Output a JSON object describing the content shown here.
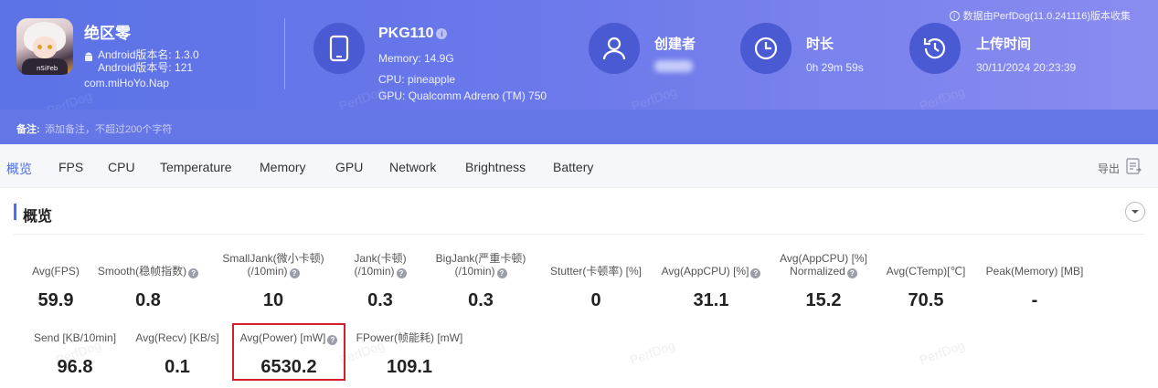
{
  "app": {
    "name": "绝区零",
    "version_name": "Android版本名: 1.3.0",
    "version_code": "Android版本号: 121",
    "package": "com.miHoYo.Nap",
    "icon_tag": "nSiFeb"
  },
  "device": {
    "name": "PKG110",
    "memory": "Memory: 14.9G",
    "cpu": "CPU: pineapple",
    "gpu": "GPU: Qualcomm Adreno (TM) 750"
  },
  "creator": {
    "label": "创建者"
  },
  "duration": {
    "label": "时长",
    "value": "0h 29m 59s"
  },
  "upload": {
    "label": "上传时间",
    "value": "30/11/2024 20:23:39"
  },
  "source_note": "数据由PerfDog(11.0.241116)版本收集",
  "notes": {
    "label": "备注:",
    "placeholder": "添加备注，不超过200个字符"
  },
  "tabs": [
    "概览",
    "FPS",
    "CPU",
    "Temperature",
    "Memory",
    "GPU",
    "Network",
    "Brightness",
    "Battery"
  ],
  "export_label": "导出",
  "overview": {
    "title": "概览",
    "row1": [
      {
        "l1": "Avg(FPS)",
        "l2": "",
        "q": false,
        "value": "59.9"
      },
      {
        "l1": "Smooth(稳帧指数)",
        "l2": "",
        "q": true,
        "value": "0.8"
      },
      {
        "l1": "SmallJank(微小卡顿)",
        "l2": "(/10min)",
        "q": true,
        "value": "10"
      },
      {
        "l1": "Jank(卡顿)",
        "l2": "(/10min)",
        "q": true,
        "value": "0.3"
      },
      {
        "l1": "BigJank(严重卡顿)",
        "l2": "(/10min)",
        "q": true,
        "value": "0.3"
      },
      {
        "l1": "Stutter(卡顿率) [%]",
        "l2": "",
        "q": false,
        "value": "0"
      },
      {
        "l1": "Avg(AppCPU) [%]",
        "l2": "",
        "q": true,
        "value": "31.1"
      },
      {
        "l1": "Avg(AppCPU) [%]",
        "l2": "Normalized",
        "q": true,
        "value": "15.2"
      },
      {
        "l1": "Avg(CTemp)[℃]",
        "l2": "",
        "q": false,
        "value": "70.5"
      },
      {
        "l1": "Peak(Memory) [MB]",
        "l2": "",
        "q": false,
        "value": "-"
      }
    ],
    "row2": [
      {
        "l1": "Send [KB/10min]",
        "q": false,
        "value": "96.8"
      },
      {
        "l1": "Avg(Recv) [KB/s]",
        "q": false,
        "value": "0.1"
      },
      {
        "l1": "Avg(Power) [mW]",
        "q": true,
        "value": "6530.2"
      },
      {
        "l1": "FPower(帧能耗) [mW]",
        "q": false,
        "value": "109.1"
      }
    ]
  },
  "watermark": "PerfDog",
  "colors": {
    "header": "#5b72e6",
    "accent": "#4a6cf0",
    "highlight": "#d21f2a"
  },
  "icons": [
    "android-icon",
    "phone-icon",
    "user-icon",
    "clock-icon",
    "history-icon",
    "info-icon",
    "export-icon",
    "chevron-down-icon",
    "help-icon"
  ]
}
